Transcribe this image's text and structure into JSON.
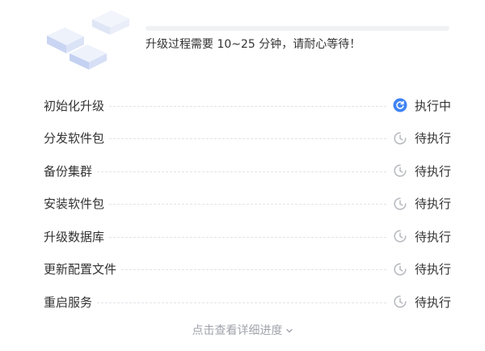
{
  "header": {
    "progress_fraction": 0.0,
    "hint_text": "升级过程需要 10~25 分钟，请耐心等待！"
  },
  "colors": {
    "accent": "#3f84f5",
    "pending_icon": "#b6b8be",
    "divider": "#e1e3e8",
    "muted_text": "#a0a3ab"
  },
  "steps": [
    {
      "label": "初始化升级",
      "status": "执行中",
      "icon": "refresh-icon"
    },
    {
      "label": "分发软件包",
      "status": "待执行",
      "icon": "clock-icon"
    },
    {
      "label": "备份集群",
      "status": "待执行",
      "icon": "clock-icon"
    },
    {
      "label": "安装软件包",
      "status": "待执行",
      "icon": "clock-icon"
    },
    {
      "label": "升级数据库",
      "status": "待执行",
      "icon": "clock-icon"
    },
    {
      "label": "更新配置文件",
      "status": "待执行",
      "icon": "clock-icon"
    },
    {
      "label": "重启服务",
      "status": "待执行",
      "icon": "clock-icon"
    }
  ],
  "footer": {
    "details_label": "点击查看详细进度",
    "details_icon": "chevron-down-icon"
  }
}
